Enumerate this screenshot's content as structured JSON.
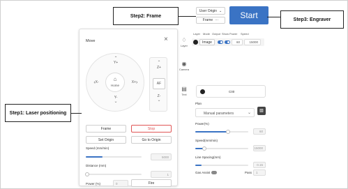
{
  "callouts": {
    "step1": "Step1:  Laser positioning",
    "step2": "Step2:  Frame",
    "step3": "Step3:  Engraver"
  },
  "toolbar": {
    "origin_select": "User Origin",
    "frame_button": "Frame",
    "frame_more": "···",
    "start_button": "Start"
  },
  "move_panel": {
    "title": "Move",
    "jog": {
      "up": "Y+",
      "down": "Y-",
      "left": "X-",
      "right": "X+",
      "home": "Home"
    },
    "z": {
      "up": "Z+",
      "af": "AF",
      "down": "Z-"
    },
    "frame_button": "Frame",
    "stop_button": "Stop",
    "set_origin_button": "Set Origin",
    "go_to_origin_button": "Go to Origin",
    "speed_label": "Speed (mm/min)",
    "speed_value": "5000",
    "speed_fraction": 0.3,
    "distance_label": "Distance (mm)",
    "distance_value": "1",
    "distance_fraction": 0.02,
    "power_label": "Power (%)",
    "power_value": "0",
    "fire_button": "Fire"
  },
  "side_tabs": [
    {
      "label": "Layer",
      "icon": "layers-icon"
    },
    {
      "label": "Camera",
      "icon": "camera-icon"
    },
    {
      "label": "Text",
      "icon": "text-icon"
    }
  ],
  "layer_table": {
    "headers": [
      "Layer",
      "Mode",
      "Output",
      "Show",
      "Power",
      "Speed"
    ],
    "row": {
      "mode": "Image",
      "power": "60",
      "speed": "15000"
    }
  },
  "settings": {
    "material": "C00",
    "plan_label": "Plan",
    "plan_value": "Manual parameters",
    "power_label": "Power(%)",
    "power_value": "60",
    "power_fraction": 0.6,
    "speed_label": "Speed(mm/min)",
    "speed_value": "15000",
    "speed_fraction": 0.15,
    "line_spacing_label": "Line Spacing(mm)",
    "line_spacing_value": "0.15",
    "line_spacing_fraction": 0.12,
    "gas_assist_label": "Gas Assist",
    "pass_label": "Pass",
    "pass_value": "1"
  },
  "colors": {
    "accent": "#3a73c4",
    "stop": "#e05555"
  }
}
